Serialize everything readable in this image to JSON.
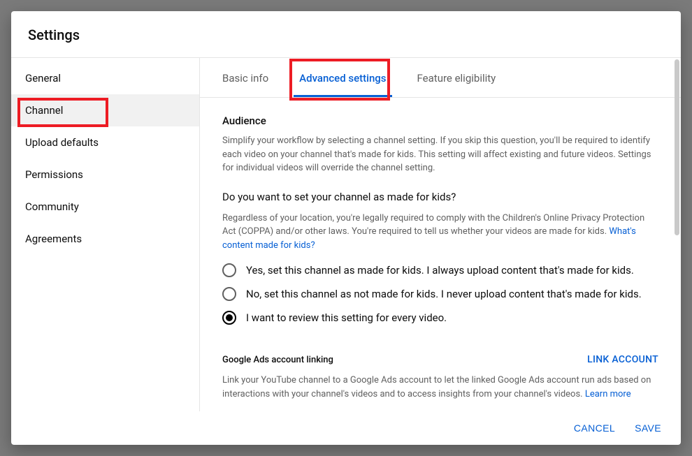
{
  "dialog": {
    "title": "Settings"
  },
  "sidebar": {
    "items": [
      {
        "label": "General"
      },
      {
        "label": "Channel"
      },
      {
        "label": "Upload defaults"
      },
      {
        "label": "Permissions"
      },
      {
        "label": "Community"
      },
      {
        "label": "Agreements"
      }
    ],
    "selected_index": 1
  },
  "tabs": {
    "items": [
      {
        "label": "Basic info"
      },
      {
        "label": "Advanced settings"
      },
      {
        "label": "Feature eligibility"
      }
    ],
    "active_index": 1
  },
  "audience": {
    "heading": "Audience",
    "description": "Simplify your workflow by selecting a channel setting. If you skip this question, you'll be required to identify each video on your channel that's made for kids. This setting will affect existing and future videos. Settings for individual videos will override the channel setting.",
    "question": "Do you want to set your channel as made for kids?",
    "legal_prefix": "Regardless of your location, you're legally required to comply with the Children's Online Privacy Protection Act (COPPA) and/or other laws. You're required to tell us whether your videos are made for kids. ",
    "legal_link": "What's content made for kids?",
    "options": [
      "Yes, set this channel as made for kids. I always upload content that's made for kids.",
      "No, set this channel as not made for kids. I never upload content that's made for kids.",
      "I want to review this setting for every video."
    ],
    "selected_index": 2
  },
  "ads": {
    "heading": "Google Ads account linking",
    "link_button": "LINK ACCOUNT",
    "description_prefix": "Link your YouTube channel to a Google Ads account to let the linked Google Ads account run ads based on interactions with your channel's videos and to access insights from your channel's videos. ",
    "learn_more": "Learn more"
  },
  "footer": {
    "cancel": "CANCEL",
    "save": "SAVE"
  }
}
